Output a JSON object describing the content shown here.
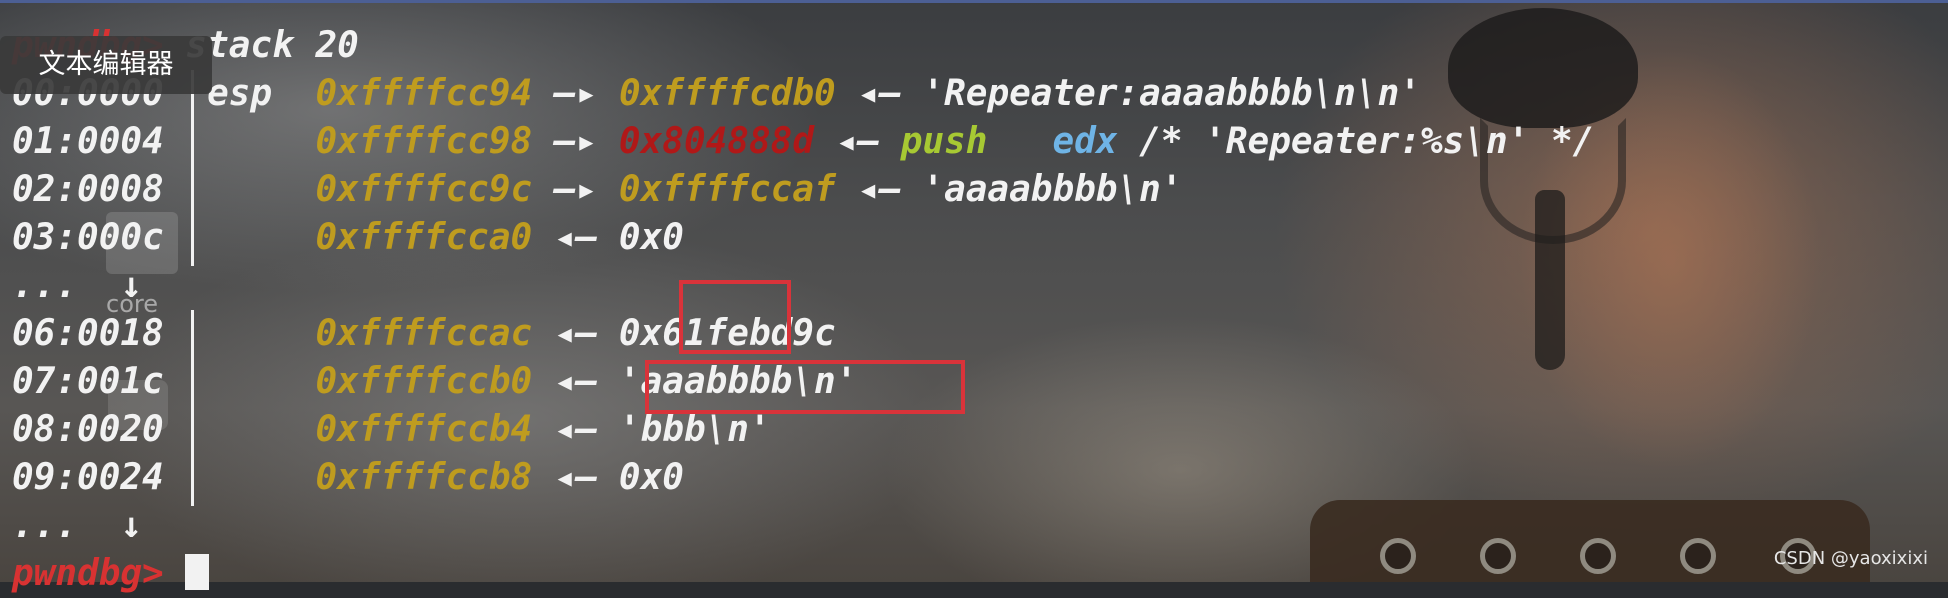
{
  "window_tooltip": "文本编辑器",
  "desktop_ghost_label": "core",
  "terminal": {
    "command_prompt": "pwndbg>",
    "command": "stack 20",
    "rows": [
      {
        "offset": "00:0000",
        "reg": "esp",
        "addr": "0xffffcc94",
        "arrow1": "—▸",
        "target": "0xffffcdb0",
        "arrow2": "◂—",
        "value": "'Repeater:aaaabbbb\\n\\n'"
      },
      {
        "offset": "01:0004",
        "addr": "0xffffcc98",
        "arrow1": "—▸",
        "target": "0x804888d",
        "arrow2": "◂—",
        "instr": "push",
        "operand": "edx",
        "comment": "/* 'Repeater:%s\\n' */"
      },
      {
        "offset": "02:0008",
        "addr": "0xffffcc9c",
        "arrow1": "—▸",
        "target": "0xffffccaf",
        "arrow2": "◂—",
        "value": "'aaaabbbb\\n'"
      },
      {
        "offset": "03:000c",
        "addr": "0xffffcca0",
        "arrow2": "◂—",
        "value": "0x0"
      },
      {
        "ellipsis": "...",
        "arrow": "↓"
      },
      {
        "offset": "06:0018",
        "addr": "0xffffccac",
        "arrow2": "◂—",
        "value": "0x61febd9c"
      },
      {
        "offset": "07:001c",
        "addr": "0xffffccb0",
        "arrow2": "◂—",
        "value": "'aaabbbb\\n'"
      },
      {
        "offset": "08:0020",
        "addr": "0xffffccb4",
        "arrow2": "◂—",
        "value": "'bbb\\n'"
      },
      {
        "offset": "09:0024",
        "addr": "0xffffccb8",
        "arrow2": "◂—",
        "value": "0x0"
      },
      {
        "ellipsis": "...",
        "arrow": "↓"
      }
    ],
    "final_prompt": "pwndbg>"
  },
  "watermark": "CSDN @yaoxixixi",
  "colors": {
    "address": "#bf9c1f",
    "code_pointer": "#b01818",
    "instruction": "#a7c933",
    "register": "#6fb4e6",
    "prompt": "#d83232",
    "highlight_box": "#d9333a"
  }
}
